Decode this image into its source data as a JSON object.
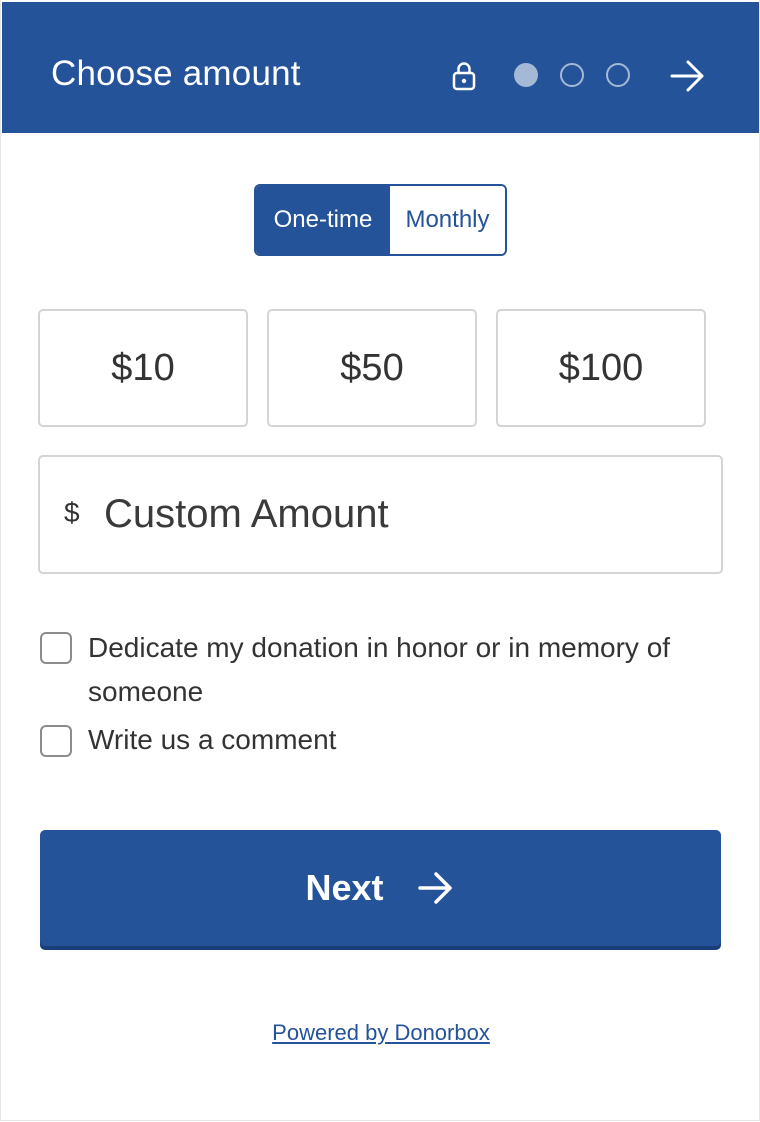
{
  "header": {
    "title": "Choose amount",
    "step_current": 1,
    "step_total": 3,
    "lock_icon": "lock-icon",
    "next_icon": "arrow-right-icon"
  },
  "frequency": {
    "options": [
      "One-time",
      "Monthly"
    ],
    "selected": "One-time"
  },
  "amounts": [
    "$10",
    "$50",
    "$100"
  ],
  "custom": {
    "currency_symbol": "$",
    "placeholder": "Custom Amount",
    "value": ""
  },
  "options": {
    "dedicate_label": "Dedicate my donation in honor or in memory of someone",
    "dedicate_checked": false,
    "comment_label": "Write us a comment",
    "comment_checked": false
  },
  "next_button": {
    "label": "Next"
  },
  "footer": {
    "powered_by": "Powered by Donorbox"
  },
  "colors": {
    "brand": "#24539a",
    "step_inactive": "#a4b9d6",
    "border": "#d4d4d4"
  }
}
